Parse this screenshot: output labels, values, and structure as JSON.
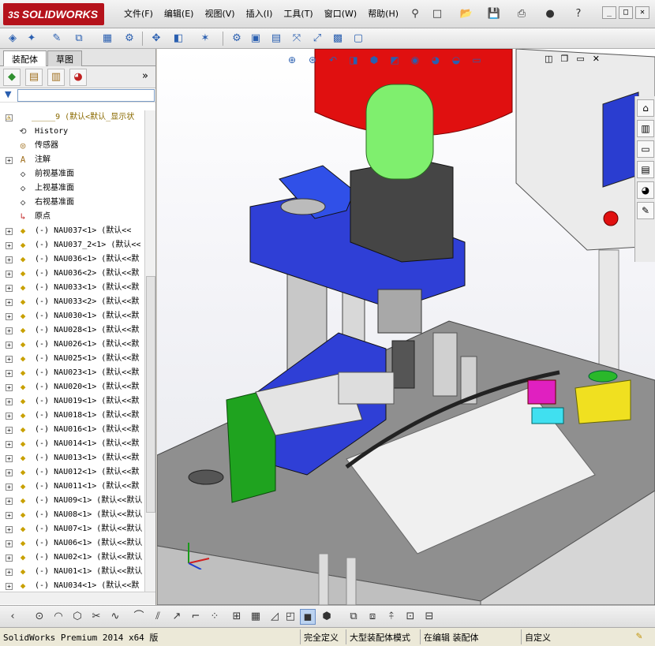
{
  "app": {
    "logo_text": "SOLIDWORKS",
    "logo_prefix": "3S",
    "menus": [
      "文件(F)",
      "编辑(E)",
      "视图(V)",
      "插入(I)",
      "工具(T)",
      "窗口(W)",
      "帮助(H)"
    ]
  },
  "panel": {
    "tabs": [
      "装配体",
      "草图"
    ],
    "active_tab": "装配体",
    "expand_arrow": "»",
    "tree": [
      {
        "label": "_____9  (默认<默认_显示状",
        "icon": "assembly-warning-icon",
        "expand": "-"
      },
      {
        "label": "History",
        "icon": "history-icon",
        "expand": ""
      },
      {
        "label": "传感器",
        "icon": "sensor-icon",
        "expand": ""
      },
      {
        "label": "注解",
        "icon": "annotation-icon",
        "expand": "+"
      },
      {
        "label": "前视基准面",
        "icon": "plane-icon",
        "expand": ""
      },
      {
        "label": "上视基准面",
        "icon": "plane-icon",
        "expand": ""
      },
      {
        "label": "右视基准面",
        "icon": "plane-icon",
        "expand": ""
      },
      {
        "label": "原点",
        "icon": "origin-icon",
        "expand": ""
      },
      {
        "label": "(-) NAU037<1> (默认<<",
        "icon": "part-icon",
        "expand": "+"
      },
      {
        "label": "(-) NAU037_2<1> (默认<<",
        "icon": "part-icon",
        "expand": "+"
      },
      {
        "label": "(-) NAU036<1> (默认<<默",
        "icon": "part-icon",
        "expand": "+"
      },
      {
        "label": "(-) NAU036<2> (默认<<默",
        "icon": "part-icon",
        "expand": "+"
      },
      {
        "label": "(-) NAU033<1> (默认<<默",
        "icon": "part-icon",
        "expand": "+"
      },
      {
        "label": "(-) NAU033<2> (默认<<默",
        "icon": "part-icon",
        "expand": "+"
      },
      {
        "label": "(-) NAU030<1> (默认<<默",
        "icon": "part-icon",
        "expand": "+"
      },
      {
        "label": "(-) NAU028<1> (默认<<默",
        "icon": "part-icon",
        "expand": "+"
      },
      {
        "label": "(-) NAU026<1> (默认<<默",
        "icon": "part-icon",
        "expand": "+"
      },
      {
        "label": "(-) NAU025<1> (默认<<默",
        "icon": "part-icon",
        "expand": "+"
      },
      {
        "label": "(-) NAU023<1> (默认<<默",
        "icon": "part-icon",
        "expand": "+"
      },
      {
        "label": "(-) NAU020<1> (默认<<默",
        "icon": "part-icon",
        "expand": "+"
      },
      {
        "label": "(-) NAU019<1> (默认<<默",
        "icon": "part-icon",
        "expand": "+"
      },
      {
        "label": "(-) NAU018<1> (默认<<默",
        "icon": "part-icon",
        "expand": "+"
      },
      {
        "label": "(-) NAU016<1> (默认<<默",
        "icon": "part-icon",
        "expand": "+"
      },
      {
        "label": "(-) NAU014<1> (默认<<默",
        "icon": "part-icon",
        "expand": "+"
      },
      {
        "label": "(-) NAU013<1> (默认<<默",
        "icon": "part-icon",
        "expand": "+"
      },
      {
        "label": "(-) NAU012<1> (默认<<默",
        "icon": "part-icon",
        "expand": "+"
      },
      {
        "label": "(-) NAU011<1> (默认<<默",
        "icon": "part-icon",
        "expand": "+"
      },
      {
        "label": "(-) NAU09<1> (默认<<默认",
        "icon": "part-icon",
        "expand": "+"
      },
      {
        "label": "(-) NAU08<1> (默认<<默认",
        "icon": "part-icon",
        "expand": "+"
      },
      {
        "label": "(-) NAU07<1> (默认<<默认",
        "icon": "part-icon",
        "expand": "+"
      },
      {
        "label": "(-) NAU06<1> (默认<<默认",
        "icon": "part-icon",
        "expand": "+"
      },
      {
        "label": "(-) NAU02<1> (默认<<默认",
        "icon": "part-icon",
        "expand": "+"
      },
      {
        "label": "(-) NAU01<1> (默认<<默认",
        "icon": "part-icon",
        "expand": "+"
      },
      {
        "label": "(-) NAU034<1> (默认<<默",
        "icon": "part-icon",
        "expand": "+"
      }
    ]
  },
  "status": {
    "product": "SolidWorks Premium 2014 x64 版",
    "fully_defined": "完全定义",
    "large_assembly": "大型装配体模式",
    "editing": "在编辑 装配体",
    "custom": "自定义"
  },
  "colors": {
    "logo_red": "#b5121b",
    "blue_part": "#2f3fd6",
    "green_part": "#1fa31f",
    "red_tank": "#e01010",
    "table_gray": "#8a8a8a"
  }
}
